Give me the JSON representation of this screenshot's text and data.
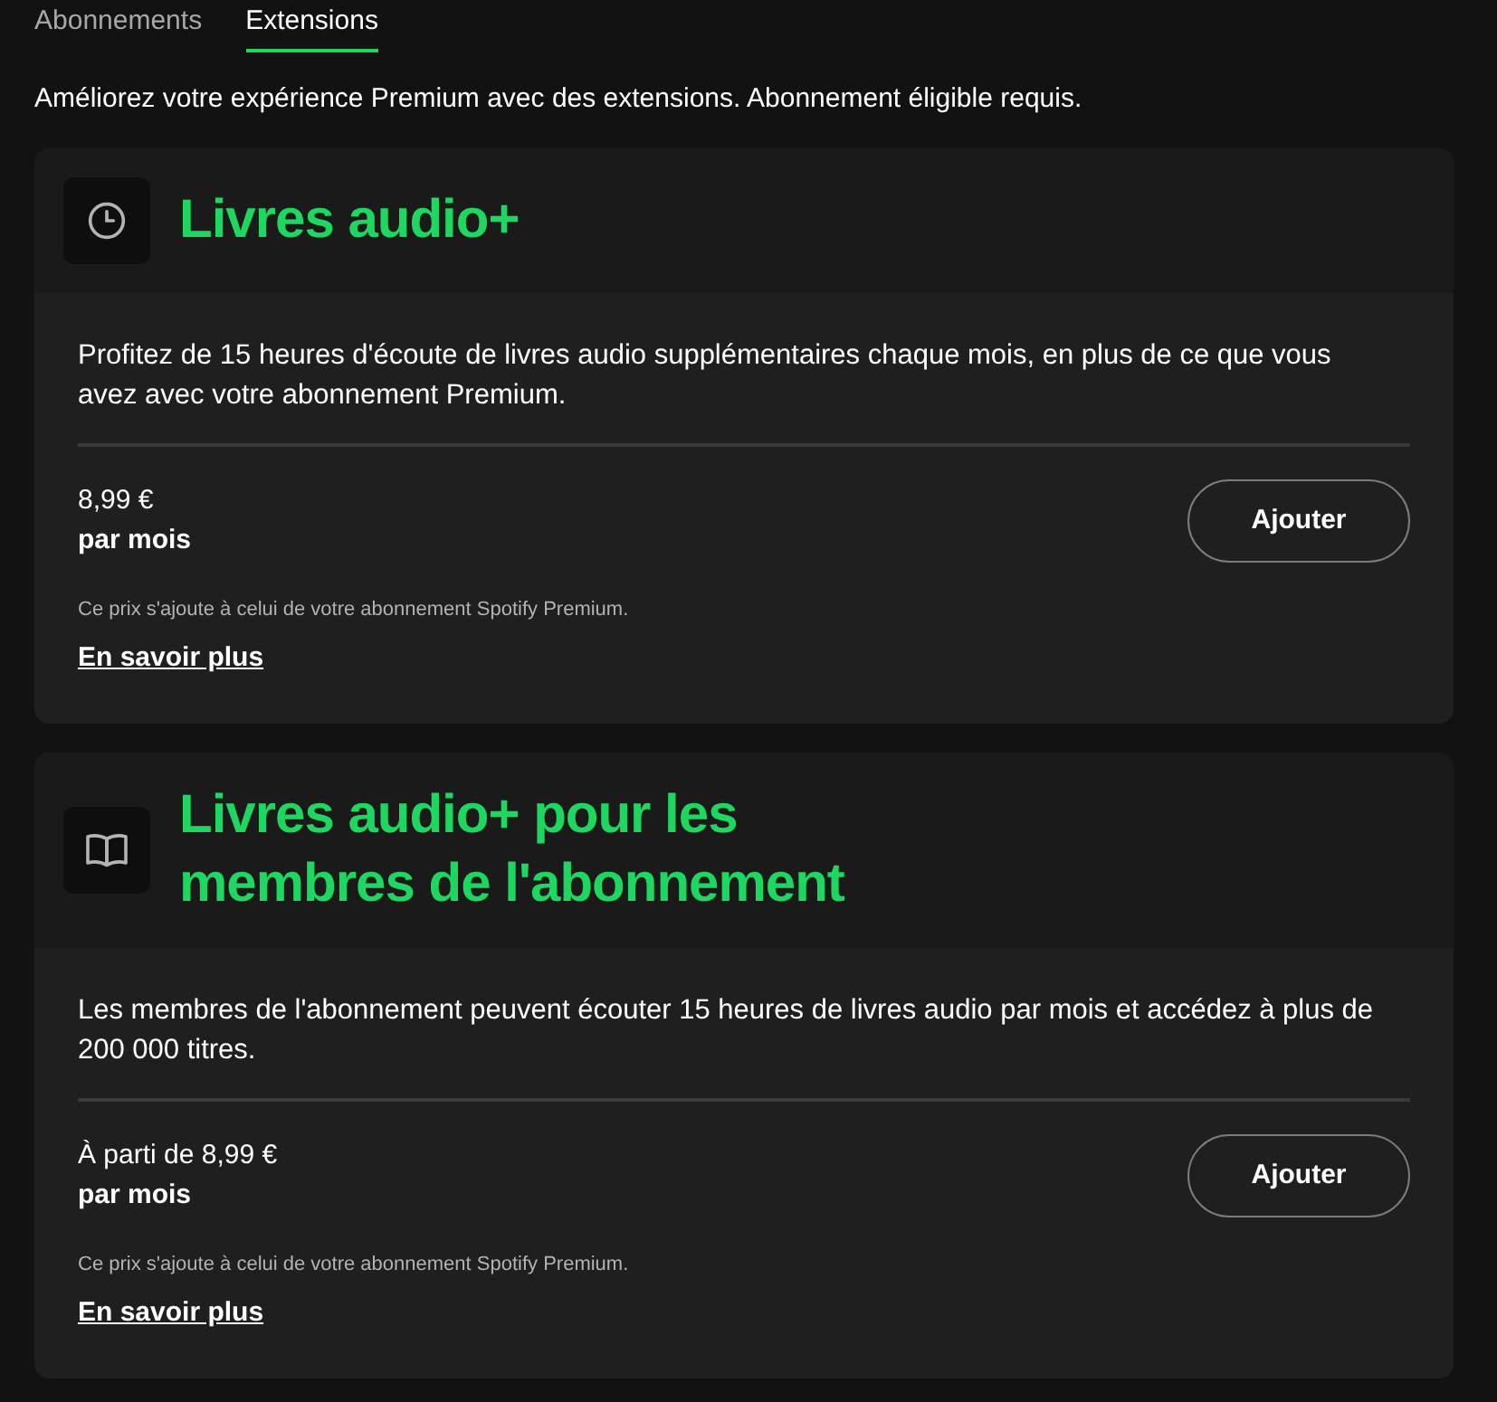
{
  "tabs": [
    {
      "label": "Abonnements",
      "selected": false
    },
    {
      "label": "Extensions",
      "selected": true
    }
  ],
  "intro": "Améliorez votre expérience Premium avec des extensions. Abonnement éligible requis.",
  "addons": [
    {
      "kind": "clock",
      "title": "Livres audio+",
      "description": "Profitez de 15 heures d'écoute de livres audio supplémentaires chaque mois, en plus de ce que vous avez avec votre abonnement Premium.",
      "price": "8,99 €",
      "period": "par mois",
      "button": "Ajouter",
      "note": "Ce prix s'ajoute à celui de votre abonnement Spotify Premium.",
      "link": "En savoir plus"
    },
    {
      "kind": "book",
      "title": "Livres audio+ pour les membres de l'abonnement",
      "description": "Les membres de l'abonnement peuvent écouter 15 heures de livres audio par mois et accédez à plus de 200 000 titres.",
      "price": "À parti de 8,99 €",
      "period": "par mois",
      "button": "Ajouter",
      "note": "Ce prix s'ajoute à celui de votre abonnement Spotify Premium.",
      "link": "En savoir plus"
    }
  ]
}
